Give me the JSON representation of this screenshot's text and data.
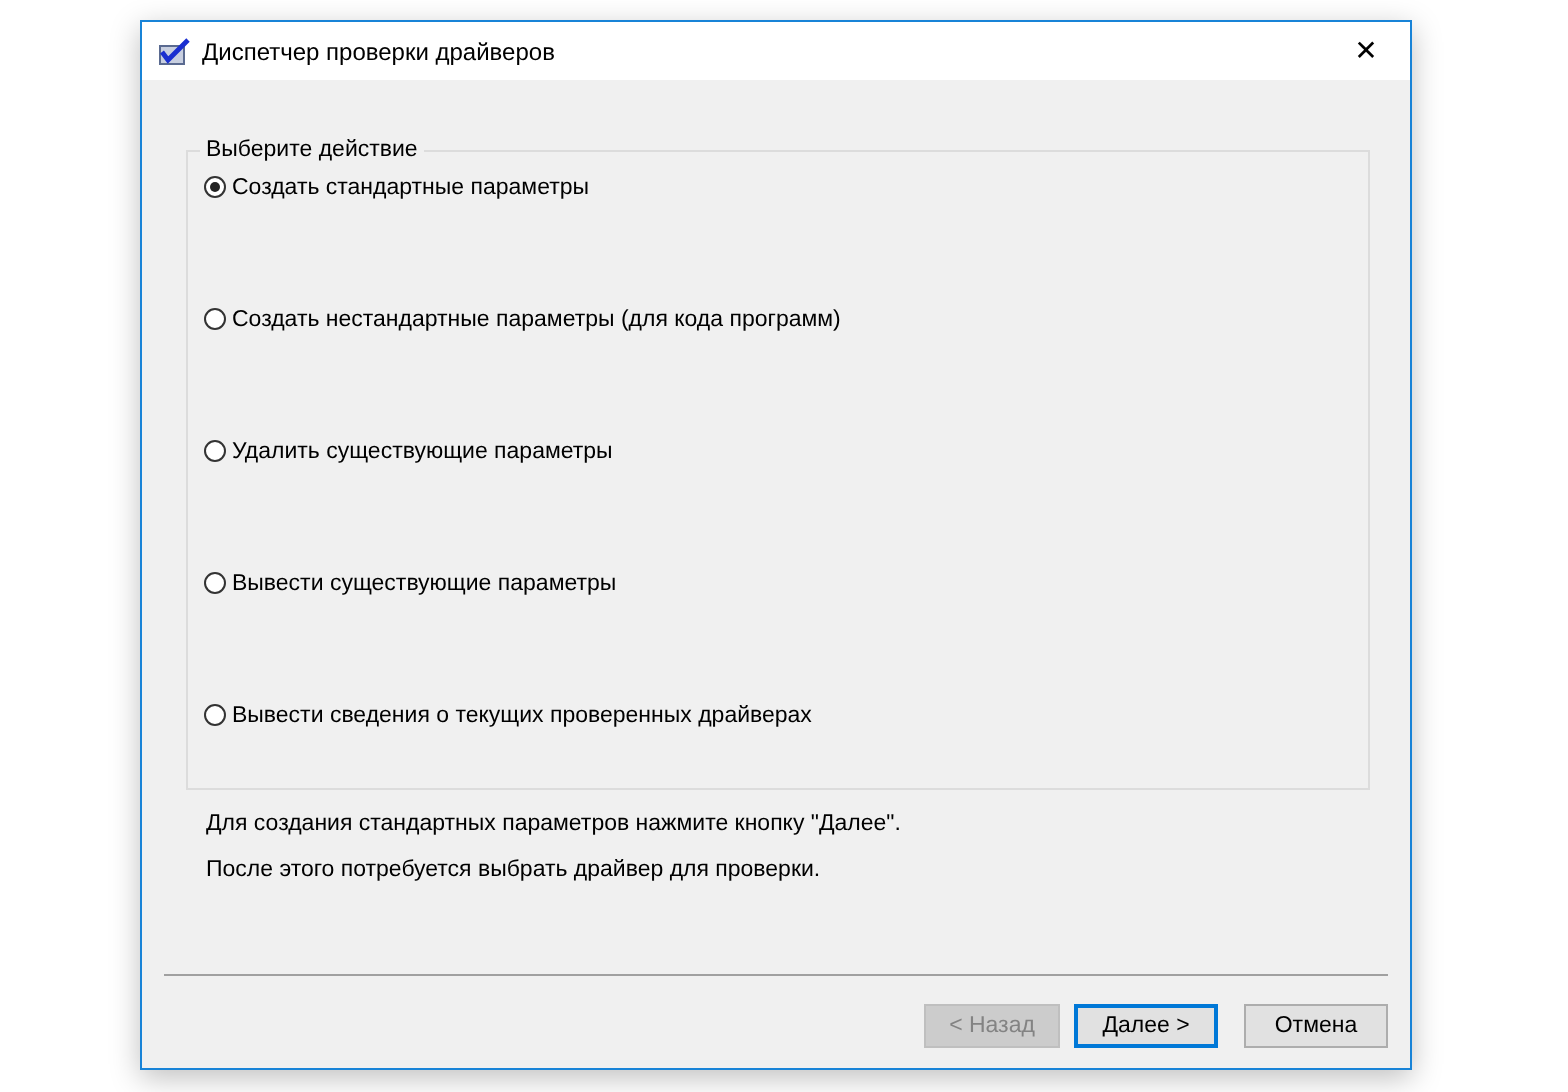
{
  "window": {
    "title": "Диспетчер проверки драйверов",
    "close": "✕"
  },
  "group": {
    "legend": "Выберите действие",
    "options": [
      {
        "label": "Создать стандартные параметры",
        "selected": true
      },
      {
        "label": "Создать нестандартные параметры (для кода программ)",
        "selected": false
      },
      {
        "label": "Удалить существующие параметры",
        "selected": false
      },
      {
        "label": "Вывести существующие параметры",
        "selected": false
      },
      {
        "label": "Вывести сведения о текущих проверенных драйверах",
        "selected": false
      }
    ]
  },
  "info": [
    "Для создания стандартных параметров нажмите кнопку \"Далее\".",
    "После этого потребуется выбрать драйвер для проверки."
  ],
  "buttons": [
    {
      "label": "< Назад",
      "disabled": true,
      "default": false
    },
    {
      "label": "Далее >",
      "disabled": false,
      "default": true
    },
    {
      "label": "Отмена",
      "disabled": false,
      "default": false
    }
  ]
}
